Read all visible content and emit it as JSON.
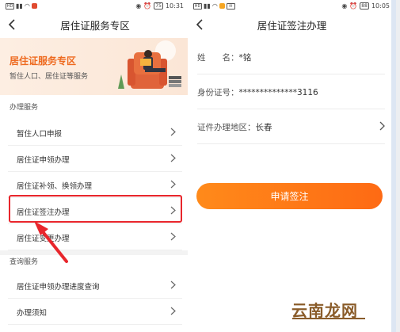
{
  "left_screen": {
    "status": {
      "time": "10:31",
      "battery": "75"
    },
    "title": "居住证服务专区",
    "banner": {
      "title": "居住证服务专区",
      "subtitle": "暂住人口、居住证等服务"
    },
    "sections": [
      {
        "label": "办理服务",
        "items": [
          "暂住人口申报",
          "居住证申领办理",
          "居住证补领、换领办理",
          "居住证签注办理",
          "居住证变更办理"
        ]
      },
      {
        "label": "查询服务",
        "items": [
          "居住证申领办理进度查询",
          "办理须知"
        ]
      }
    ],
    "highlighted_item": "居住证签注办理",
    "colors": {
      "accent": "#ee6a1f",
      "highlight": "#e8262c"
    }
  },
  "right_screen": {
    "status": {
      "time": "10:05",
      "battery": "88"
    },
    "title": "居住证签注办理",
    "fields": [
      {
        "label": "姓　　名：",
        "value": "*铭"
      },
      {
        "label": "身份证号：",
        "value": "**************3116"
      },
      {
        "label": "证件办理地区：",
        "value": "长春"
      }
    ],
    "apply_button": "申请签注",
    "colors": {
      "button": "#fe7a18"
    }
  },
  "watermark": "云南龙网",
  "icons": [
    "back-icon",
    "chevron-right-icon",
    "signal-icon",
    "wifi-icon",
    "alarm-icon",
    "battery-icon",
    "eye-icon"
  ]
}
